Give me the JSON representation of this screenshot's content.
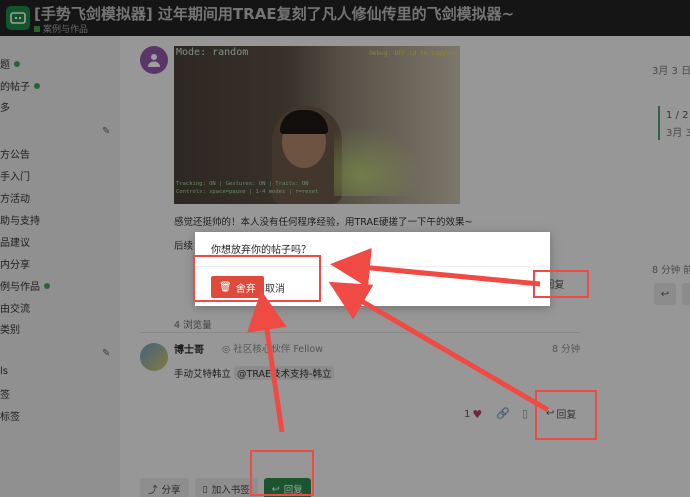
{
  "header": {
    "title": "[手势飞剑模拟器] 过年期间用TRAE复刻了凡人修仙传里的飞剑模拟器~",
    "category": "案例与作品"
  },
  "sidebar": {
    "items": [
      {
        "label": "题"
      },
      {
        "label": "的帖子"
      },
      {
        "label": "多"
      },
      {
        "label": "方公告"
      },
      {
        "label": "手入门"
      },
      {
        "label": "方活动"
      },
      {
        "label": "助与支持"
      },
      {
        "label": "品建议"
      },
      {
        "label": "内分享"
      },
      {
        "label": "例与作品"
      },
      {
        "label": "由交流"
      },
      {
        "label": "类别"
      },
      {
        "label": "ls"
      },
      {
        "label": "签"
      },
      {
        "label": "标签"
      }
    ]
  },
  "post": {
    "video": {
      "mode_text": "Mode: random",
      "debug_text": "Debug: OFF (d to toggle)",
      "status_line1": "Tracking: ON | Gestures: ON | Trails: ON",
      "status_line2": "Controls: space=pause | 1-4 modes | r=reset"
    },
    "text1": "感觉还挺帅的！本人没有任何程序经验，用TRAE硬搓了一下午的效果~",
    "text2": "后续",
    "views": "4 浏览量"
  },
  "reply": {
    "author": "博士哥",
    "flair": "社区核心伙伴 Fellow",
    "time": "8 分钟",
    "body_prefix": "手动艾特韩立",
    "mention": "@TRAE技术支持-韩立",
    "likes": "1",
    "reply_label": "回复"
  },
  "bottom_bar": {
    "share_label": "分享",
    "bookmark_label": "加入书签",
    "reply_label": "回复"
  },
  "right_rail": {
    "date_top": "3月 3 日",
    "position": "1 / 2",
    "date_bottom": "3月 3",
    "time2": "8 分钟 前"
  },
  "post_reply_label": "回复",
  "modal": {
    "question": "你想放弃你的帖子吗？",
    "discard_label": "舍弃",
    "cancel_label": "取消"
  },
  "colors": {
    "accent_green": "#2c8a4c",
    "danger_red": "#e04a3b",
    "annotation_red": "#f04a45"
  }
}
